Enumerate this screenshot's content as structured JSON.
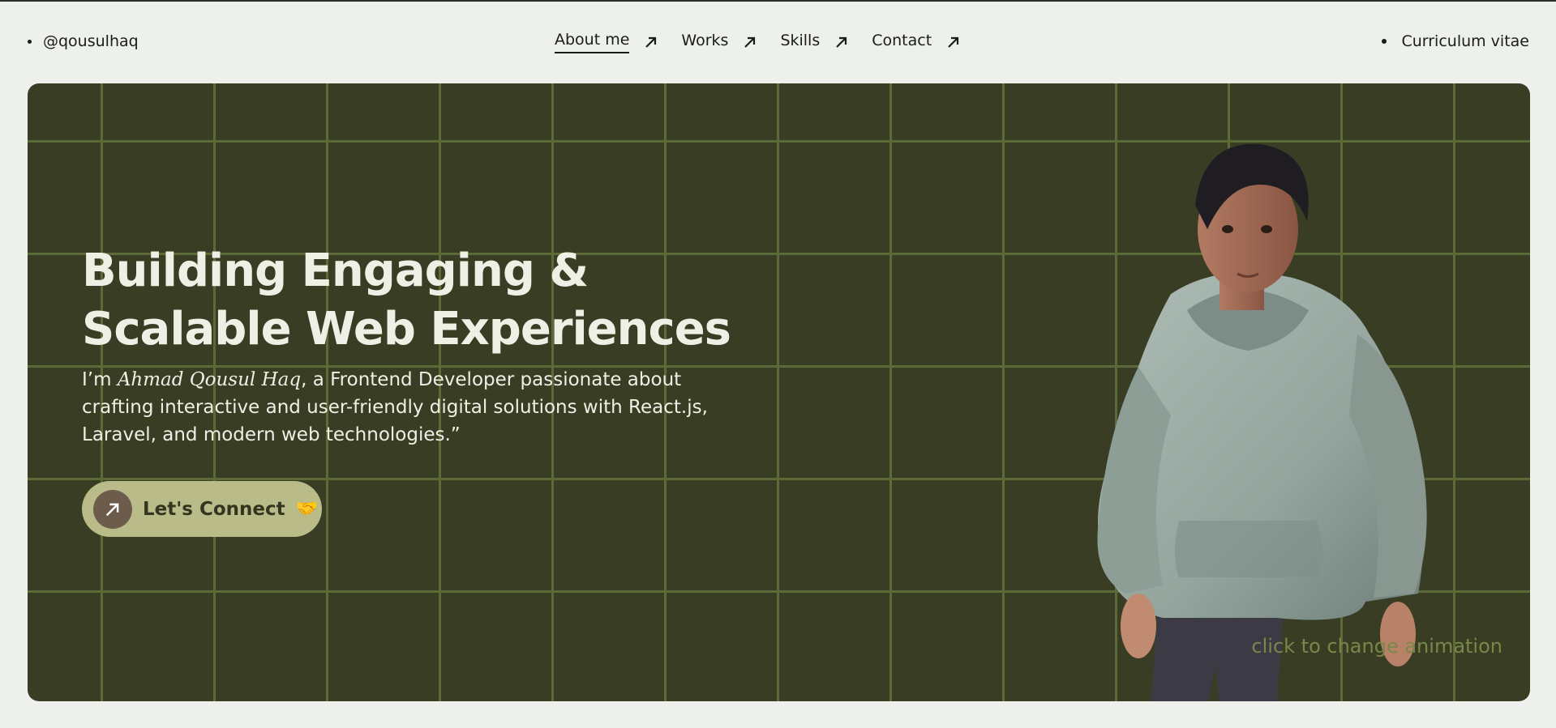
{
  "header": {
    "handle": "@qousulhaq",
    "nav": [
      {
        "label": "About me",
        "active": true
      },
      {
        "label": "Works",
        "active": false
      },
      {
        "label": "Skills",
        "active": false
      },
      {
        "label": "Contact",
        "active": false
      }
    ],
    "cv_label": "Curriculum vitae"
  },
  "hero": {
    "title_line1": "Building Engaging &",
    "title_line2": "Scalable Web Experiences",
    "desc_prefix": "I’m ",
    "desc_name": "Ahmad Qousul Haq",
    "desc_rest": ", a Frontend Developer passionate about crafting interactive and user-friendly digital solutions with React.js, Laravel, and modern web technologies.”",
    "connect_label": "Let's Connect",
    "connect_emoji": "🤝",
    "animation_hint": "click to change animation"
  },
  "icons": {
    "nav_arrow": "arrow-up-right-icon",
    "connect_arrow": "arrow-up-right-icon",
    "avatar": "3d-avatar-hoodie"
  },
  "colors": {
    "page_bg": "#eef0eb",
    "hero_bg": "#383d24",
    "grid": "#5b6a36",
    "button_bg": "#b9bb89",
    "button_circle": "#6d5b4c",
    "hint_text": "#7a8749"
  }
}
